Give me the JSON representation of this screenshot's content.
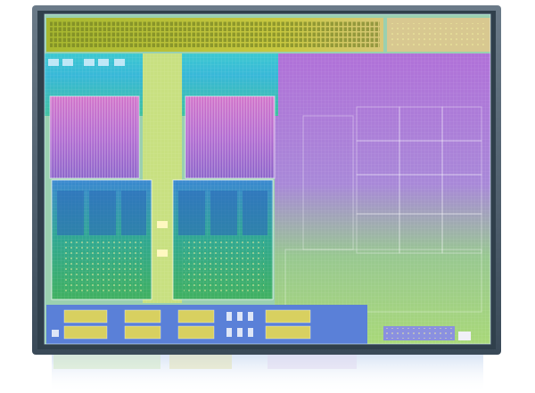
{
  "image": {
    "subject": "die-shot-photograph",
    "background_color": "#ffffff",
    "colors": {
      "frame_shadow": "#5a6a78",
      "die_base": "#8fd6a8",
      "top_io_strip": "#b9c03a",
      "cyan_left": "#30c8d8",
      "magenta_cache": "#c060c8",
      "core_green": "#2fa060",
      "core_blue": "#2a78c8",
      "gpu_purple": "#b070d8",
      "gpu_green": "#90d060",
      "interconnect_yellow": "#d8e060",
      "io_block_gold": "#d8d060",
      "bottom_blue": "#5a7ad8"
    }
  }
}
